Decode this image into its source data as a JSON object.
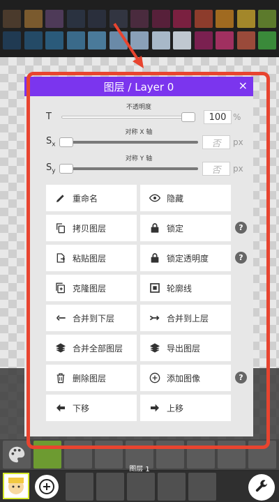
{
  "dialog": {
    "title": "图层 / Layer 0",
    "close_label": "×",
    "close_icon": "close-icon"
  },
  "opacity": {
    "label": "不透明度",
    "letter": "T",
    "value": "100",
    "unit": "%",
    "level": 1.0
  },
  "mirror_x": {
    "label": "对称 X 轴",
    "letter": "S",
    "sub": "x",
    "placeholder": "否",
    "unit": "px"
  },
  "mirror_y": {
    "label": "对称 Y 轴",
    "letter": "S",
    "sub": "y",
    "placeholder": "否",
    "unit": "px"
  },
  "actions": [
    {
      "label": "重命名",
      "icon": "pencil-icon"
    },
    {
      "label": "隐藏",
      "icon": "eye-icon"
    },
    {
      "label": "拷贝图层",
      "icon": "copy-icon"
    },
    {
      "label": "锁定",
      "icon": "lock-icon"
    },
    {
      "label": "粘贴图层",
      "icon": "paste-icon"
    },
    {
      "label": "锁定透明度",
      "icon": "lock-icon"
    },
    {
      "label": "克隆图层",
      "icon": "clone-icon"
    },
    {
      "label": "轮廓线",
      "icon": "outline-icon"
    },
    {
      "label": "合并到下层",
      "icon": "merge-down-icon"
    },
    {
      "label": "合并到上层",
      "icon": "merge-up-icon"
    },
    {
      "label": "合并全部图层",
      "icon": "layers-icon"
    },
    {
      "label": "导出图层",
      "icon": "layers-icon"
    },
    {
      "label": "删除图层",
      "icon": "trash-icon"
    },
    {
      "label": "添加图像",
      "icon": "plus-circle-icon"
    },
    {
      "label": "下移",
      "icon": "arrow-left-icon"
    },
    {
      "label": "上移",
      "icon": "arrow-right-icon"
    }
  ],
  "help_label": "?",
  "bottom": {
    "layer_label": "图层 1"
  },
  "colors": {
    "accent": "#7b35ee",
    "annotation": "#e8442f",
    "active_tool": "#6d9b31",
    "palette": [
      "#4a3a2c",
      "#7a5a2e",
      "#4e3a58",
      "#2a3240",
      "#2a2f3c",
      "#323541",
      "#4a2b3e",
      "#57203a",
      "#7a2040",
      "#8d3c2c",
      "#a06a20",
      "#a3872a",
      "#5c7a2c",
      "#203a52",
      "#244a66",
      "#2a5a7a",
      "#3a6a8a",
      "#4a7a9a",
      "#6a8aa8",
      "#8aa0b8",
      "#a8b8c8",
      "#c0c8d0",
      "#7a2050",
      "#a03060",
      "#9a4a3a",
      "#3a8a3a"
    ]
  }
}
